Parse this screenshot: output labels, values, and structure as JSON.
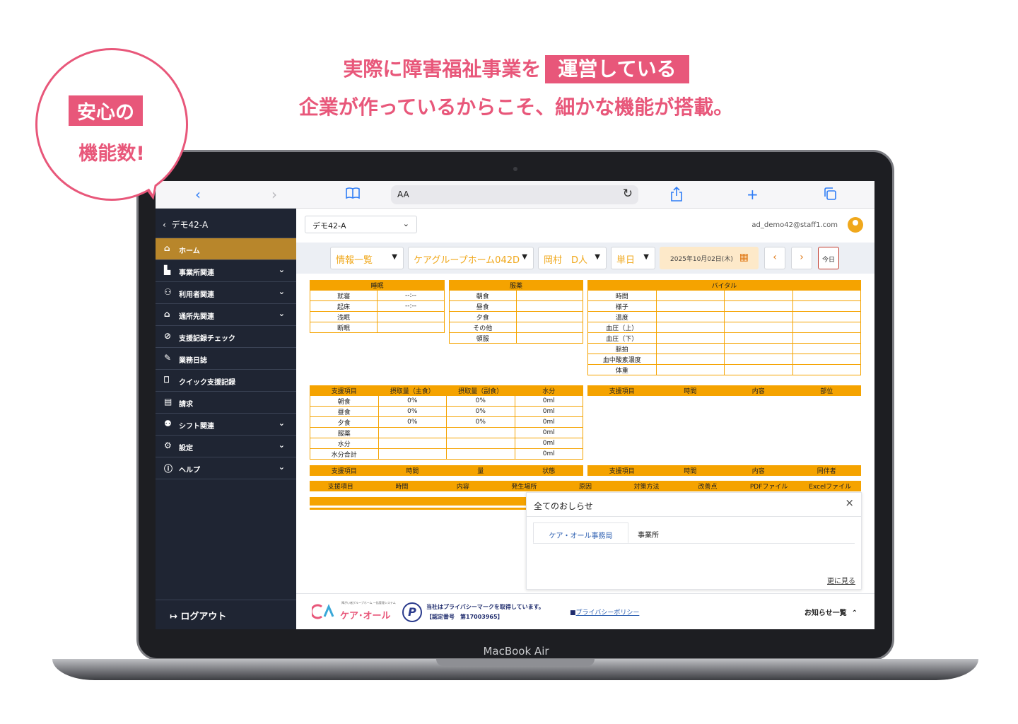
{
  "headline": {
    "line1_pre": "実際に障害福祉事業を",
    "line1_box": "運営している",
    "line2": "企業が作っているからこそ、細かな機能が搭載。"
  },
  "bubble": {
    "box_text": "安心の",
    "text": "機能数!"
  },
  "laptop": {
    "brand": "MacBook Air"
  },
  "colors": {
    "accent_pink": "#e8577a",
    "accent_orange": "#f5a300",
    "sidebar_bg": "#1f2533",
    "active_item": "#b8862b"
  },
  "browser": {
    "address_text": "AA",
    "icons": [
      "chevron-left-icon",
      "chevron-right-icon",
      "book-icon",
      "reload-icon",
      "share-icon",
      "plus-icon",
      "tabs-icon"
    ]
  },
  "sidebar": {
    "back_label": "デモ42-A",
    "items": [
      {
        "label": "ホーム",
        "icon": "home-icon",
        "active": true,
        "expandable": false
      },
      {
        "label": "事業所関連",
        "icon": "building-icon",
        "active": false,
        "expandable": true
      },
      {
        "label": "利用者関連",
        "icon": "users-icon",
        "active": false,
        "expandable": true
      },
      {
        "label": "通所先関連",
        "icon": "office-icon",
        "active": false,
        "expandable": true
      },
      {
        "label": "支援記録チェック",
        "icon": "check-circle-icon",
        "active": false,
        "expandable": false
      },
      {
        "label": "業務日誌",
        "icon": "edit-icon",
        "active": false,
        "expandable": false
      },
      {
        "label": "クイック支援記録",
        "icon": "bookmark-icon",
        "active": false,
        "expandable": false
      },
      {
        "label": "請求",
        "icon": "calculator-icon",
        "active": false,
        "expandable": false
      },
      {
        "label": "シフト関連",
        "icon": "person-gear-icon",
        "active": false,
        "expandable": true
      },
      {
        "label": "設定",
        "icon": "gear-icon",
        "active": false,
        "expandable": true
      },
      {
        "label": "ヘルプ",
        "icon": "help-icon",
        "active": false,
        "expandable": true
      }
    ],
    "logout_label": "ログアウト"
  },
  "topbar": {
    "facility": "デモ42-A",
    "user_email": "ad_demo42@staff1.com"
  },
  "filters": {
    "view": "情報一覧",
    "home": "ケアグループホーム042D",
    "user": "岡村　D人",
    "period": "単日",
    "date": "2025年10月02日(木)",
    "today": "今日"
  },
  "sleep": {
    "header": "睡眠",
    "rows": [
      {
        "label": "就寝",
        "value": "--:--"
      },
      {
        "label": "起床",
        "value": "--:--"
      },
      {
        "label": "浅眠",
        "value": ""
      },
      {
        "label": "断眠",
        "value": ""
      }
    ]
  },
  "medication": {
    "header": "服薬",
    "rows": [
      "朝食",
      "昼食",
      "夕食",
      "その他",
      "頓服"
    ]
  },
  "vital": {
    "header": "バイタル",
    "rows": [
      "時間",
      "様子",
      "温度",
      "血圧（上）",
      "血圧（下）",
      "脈拍",
      "血中酸素濃度",
      "体重"
    ]
  },
  "meal": {
    "headers": [
      "支援項目",
      "摂取量（主食）",
      "摂取量（副食）",
      "水分"
    ],
    "rows": [
      [
        "朝食",
        "0%",
        "0%",
        "0ml"
      ],
      [
        "昼食",
        "0%",
        "0%",
        "0ml"
      ],
      [
        "夕食",
        "0%",
        "0%",
        "0ml"
      ],
      [
        "服薬",
        "",
        "",
        "0ml"
      ],
      [
        "水分",
        "",
        "",
        "0ml"
      ],
      [
        "水分合計",
        "",
        "",
        "0ml"
      ]
    ]
  },
  "support_parts": {
    "headers": [
      "支援項目",
      "時間",
      "内容",
      "部位"
    ]
  },
  "excretion": {
    "headers": [
      "支援項目",
      "時間",
      "量",
      "状態"
    ]
  },
  "outing": {
    "headers": [
      "支援項目",
      "時間",
      "内容",
      "同伴者"
    ]
  },
  "incident": {
    "headers": [
      "支援項目",
      "時間",
      "内容",
      "発生場所",
      "原因",
      "対策方法",
      "改善点",
      "PDFファイル",
      "Excelファイル"
    ]
  },
  "notice": {
    "title": "全てのおしらせ",
    "tabs": [
      "ケア・オール事務局",
      "事業所"
    ],
    "more": "更に見る"
  },
  "footer": {
    "logo_tagline": "障がい者グループホーム 一括管理システム",
    "logo_name": "ケア･オール",
    "privacy_line1": "当社はプライバシーマークを取得しています。",
    "privacy_line2": "【認定番号　第17003965】",
    "privacy_link": "プライバシーポリシー",
    "notice_list": "お知らせ一覧"
  }
}
